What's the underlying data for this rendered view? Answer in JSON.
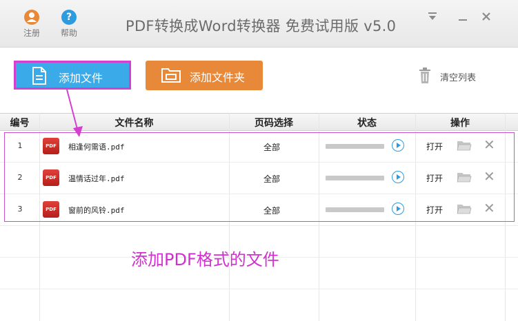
{
  "app": {
    "title": "PDF转换成Word转换器 免费试用版 v5.0"
  },
  "titlebar": {
    "register_label": "注册",
    "help_label": "帮助",
    "register_icon": "user-icon",
    "help_icon": "question-icon"
  },
  "toolbar": {
    "add_file_label": "添加文件",
    "add_folder_label": "添加文件夹",
    "clear_list_label": "清空列表"
  },
  "table": {
    "columns": [
      "编号",
      "文件名称",
      "页码选择",
      "状态",
      "操作"
    ],
    "rows": [
      {
        "num": "1",
        "name": "相逢何需语.pdf",
        "pages": "全部",
        "progress": 0,
        "action": "打开"
      },
      {
        "num": "2",
        "name": "温情话过年.pdf",
        "pages": "全部",
        "progress": 0,
        "action": "打开"
      },
      {
        "num": "3",
        "name": "窗前的风铃.pdf",
        "pages": "全部",
        "progress": 0,
        "action": "打开"
      }
    ],
    "pdf_icon_text": "PDF"
  },
  "annotation": {
    "hint": "添加PDF格式的文件"
  },
  "colors": {
    "accent_blue": "#3aaae8",
    "accent_orange": "#e8893a",
    "highlight_magenta": "#d22fd0"
  }
}
